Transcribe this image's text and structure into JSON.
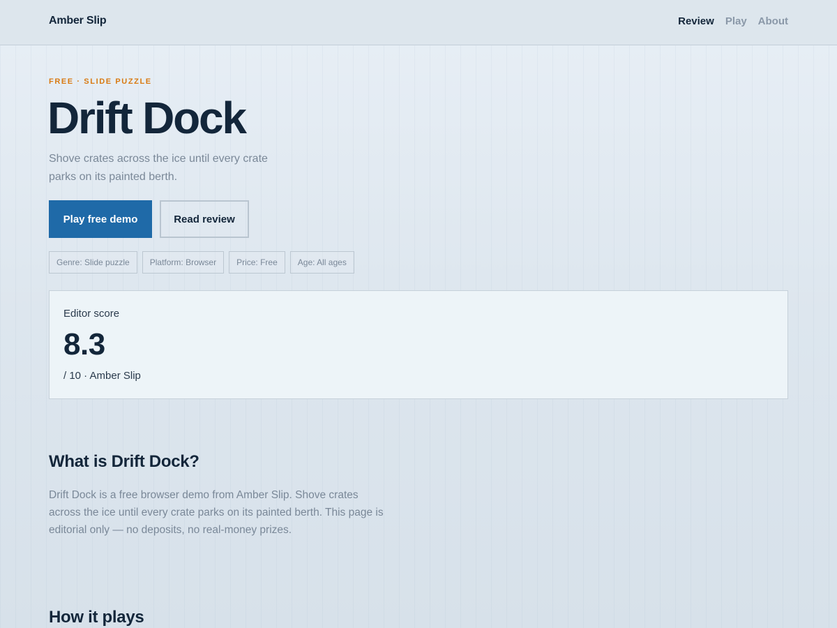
{
  "header": {
    "brand": "Amber Slip",
    "nav": [
      "Review",
      "Play",
      "About"
    ]
  },
  "hero": {
    "kicker": "FREE · SLIDE PUZZLE",
    "title": "Drift Dock",
    "subtitle": "Shove crates across the ice until every crate parks on its painted berth.",
    "primary_button": "Play free demo",
    "secondary_button": "Read review",
    "tags": [
      "Genre: Slide puzzle",
      "Platform: Browser",
      "Price: Free",
      "Age: All ages"
    ]
  },
  "score": {
    "label": "Editor score",
    "value": "8.3",
    "sub": "/ 10 · Amber Slip"
  },
  "sections": {
    "what_title": "What is Drift Dock?",
    "what_body": "Drift Dock is a free browser demo from Amber Slip. Shove crates across the ice until every crate parks on its painted berth. This page is editorial only — no deposits, no real-money prizes.",
    "how_title": "How it plays"
  },
  "colors": {
    "accent": "#d97a12",
    "primary": "#1f6aa8",
    "ink": "#13263a",
    "muted": "#7a8898"
  }
}
